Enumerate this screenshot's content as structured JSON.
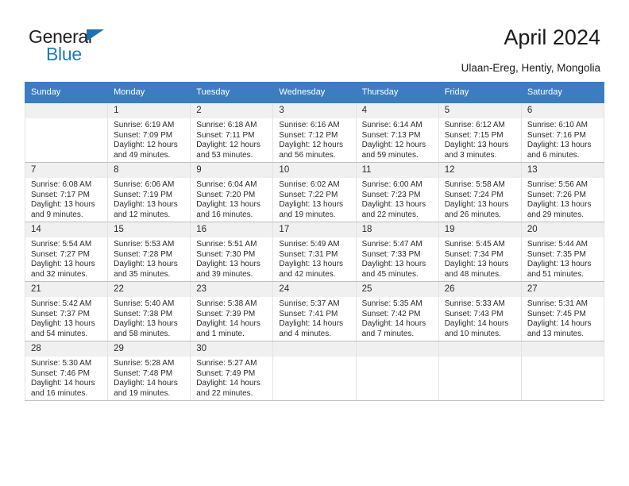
{
  "brand": {
    "line1": "General",
    "line2": "Blue",
    "triangle_color": "#1f6fb5"
  },
  "header": {
    "title": "April 2024",
    "subtitle": "Ulaan-Ereg, Hentiy, Mongolia",
    "header_bg": "#3b7dc0"
  },
  "weekdays": [
    "Sunday",
    "Monday",
    "Tuesday",
    "Wednesday",
    "Thursday",
    "Friday",
    "Saturday"
  ],
  "weeks": [
    [
      {
        "day": "",
        "blank": true,
        "sunrise": "",
        "sunset": "",
        "daylight": ""
      },
      {
        "day": "1",
        "sunrise": "Sunrise: 6:19 AM",
        "sunset": "Sunset: 7:09 PM",
        "daylight": "Daylight: 12 hours and 49 minutes."
      },
      {
        "day": "2",
        "sunrise": "Sunrise: 6:18 AM",
        "sunset": "Sunset: 7:11 PM",
        "daylight": "Daylight: 12 hours and 53 minutes."
      },
      {
        "day": "3",
        "sunrise": "Sunrise: 6:16 AM",
        "sunset": "Sunset: 7:12 PM",
        "daylight": "Daylight: 12 hours and 56 minutes."
      },
      {
        "day": "4",
        "sunrise": "Sunrise: 6:14 AM",
        "sunset": "Sunset: 7:13 PM",
        "daylight": "Daylight: 12 hours and 59 minutes."
      },
      {
        "day": "5",
        "sunrise": "Sunrise: 6:12 AM",
        "sunset": "Sunset: 7:15 PM",
        "daylight": "Daylight: 13 hours and 3 minutes."
      },
      {
        "day": "6",
        "sunrise": "Sunrise: 6:10 AM",
        "sunset": "Sunset: 7:16 PM",
        "daylight": "Daylight: 13 hours and 6 minutes."
      }
    ],
    [
      {
        "day": "7",
        "sunrise": "Sunrise: 6:08 AM",
        "sunset": "Sunset: 7:17 PM",
        "daylight": "Daylight: 13 hours and 9 minutes."
      },
      {
        "day": "8",
        "sunrise": "Sunrise: 6:06 AM",
        "sunset": "Sunset: 7:19 PM",
        "daylight": "Daylight: 13 hours and 12 minutes."
      },
      {
        "day": "9",
        "sunrise": "Sunrise: 6:04 AM",
        "sunset": "Sunset: 7:20 PM",
        "daylight": "Daylight: 13 hours and 16 minutes."
      },
      {
        "day": "10",
        "sunrise": "Sunrise: 6:02 AM",
        "sunset": "Sunset: 7:22 PM",
        "daylight": "Daylight: 13 hours and 19 minutes."
      },
      {
        "day": "11",
        "sunrise": "Sunrise: 6:00 AM",
        "sunset": "Sunset: 7:23 PM",
        "daylight": "Daylight: 13 hours and 22 minutes."
      },
      {
        "day": "12",
        "sunrise": "Sunrise: 5:58 AM",
        "sunset": "Sunset: 7:24 PM",
        "daylight": "Daylight: 13 hours and 26 minutes."
      },
      {
        "day": "13",
        "sunrise": "Sunrise: 5:56 AM",
        "sunset": "Sunset: 7:26 PM",
        "daylight": "Daylight: 13 hours and 29 minutes."
      }
    ],
    [
      {
        "day": "14",
        "sunrise": "Sunrise: 5:54 AM",
        "sunset": "Sunset: 7:27 PM",
        "daylight": "Daylight: 13 hours and 32 minutes."
      },
      {
        "day": "15",
        "sunrise": "Sunrise: 5:53 AM",
        "sunset": "Sunset: 7:28 PM",
        "daylight": "Daylight: 13 hours and 35 minutes."
      },
      {
        "day": "16",
        "sunrise": "Sunrise: 5:51 AM",
        "sunset": "Sunset: 7:30 PM",
        "daylight": "Daylight: 13 hours and 39 minutes."
      },
      {
        "day": "17",
        "sunrise": "Sunrise: 5:49 AM",
        "sunset": "Sunset: 7:31 PM",
        "daylight": "Daylight: 13 hours and 42 minutes."
      },
      {
        "day": "18",
        "sunrise": "Sunrise: 5:47 AM",
        "sunset": "Sunset: 7:33 PM",
        "daylight": "Daylight: 13 hours and 45 minutes."
      },
      {
        "day": "19",
        "sunrise": "Sunrise: 5:45 AM",
        "sunset": "Sunset: 7:34 PM",
        "daylight": "Daylight: 13 hours and 48 minutes."
      },
      {
        "day": "20",
        "sunrise": "Sunrise: 5:44 AM",
        "sunset": "Sunset: 7:35 PM",
        "daylight": "Daylight: 13 hours and 51 minutes."
      }
    ],
    [
      {
        "day": "21",
        "sunrise": "Sunrise: 5:42 AM",
        "sunset": "Sunset: 7:37 PM",
        "daylight": "Daylight: 13 hours and 54 minutes."
      },
      {
        "day": "22",
        "sunrise": "Sunrise: 5:40 AM",
        "sunset": "Sunset: 7:38 PM",
        "daylight": "Daylight: 13 hours and 58 minutes."
      },
      {
        "day": "23",
        "sunrise": "Sunrise: 5:38 AM",
        "sunset": "Sunset: 7:39 PM",
        "daylight": "Daylight: 14 hours and 1 minute."
      },
      {
        "day": "24",
        "sunrise": "Sunrise: 5:37 AM",
        "sunset": "Sunset: 7:41 PM",
        "daylight": "Daylight: 14 hours and 4 minutes."
      },
      {
        "day": "25",
        "sunrise": "Sunrise: 5:35 AM",
        "sunset": "Sunset: 7:42 PM",
        "daylight": "Daylight: 14 hours and 7 minutes."
      },
      {
        "day": "26",
        "sunrise": "Sunrise: 5:33 AM",
        "sunset": "Sunset: 7:43 PM",
        "daylight": "Daylight: 14 hours and 10 minutes."
      },
      {
        "day": "27",
        "sunrise": "Sunrise: 5:31 AM",
        "sunset": "Sunset: 7:45 PM",
        "daylight": "Daylight: 14 hours and 13 minutes."
      }
    ],
    [
      {
        "day": "28",
        "sunrise": "Sunrise: 5:30 AM",
        "sunset": "Sunset: 7:46 PM",
        "daylight": "Daylight: 14 hours and 16 minutes."
      },
      {
        "day": "29",
        "sunrise": "Sunrise: 5:28 AM",
        "sunset": "Sunset: 7:48 PM",
        "daylight": "Daylight: 14 hours and 19 minutes."
      },
      {
        "day": "30",
        "sunrise": "Sunrise: 5:27 AM",
        "sunset": "Sunset: 7:49 PM",
        "daylight": "Daylight: 14 hours and 22 minutes."
      },
      {
        "day": "",
        "blank": true,
        "sunrise": "",
        "sunset": "",
        "daylight": ""
      },
      {
        "day": "",
        "blank": true,
        "sunrise": "",
        "sunset": "",
        "daylight": ""
      },
      {
        "day": "",
        "blank": true,
        "sunrise": "",
        "sunset": "",
        "daylight": ""
      },
      {
        "day": "",
        "blank": true,
        "sunrise": "",
        "sunset": "",
        "daylight": ""
      }
    ]
  ]
}
